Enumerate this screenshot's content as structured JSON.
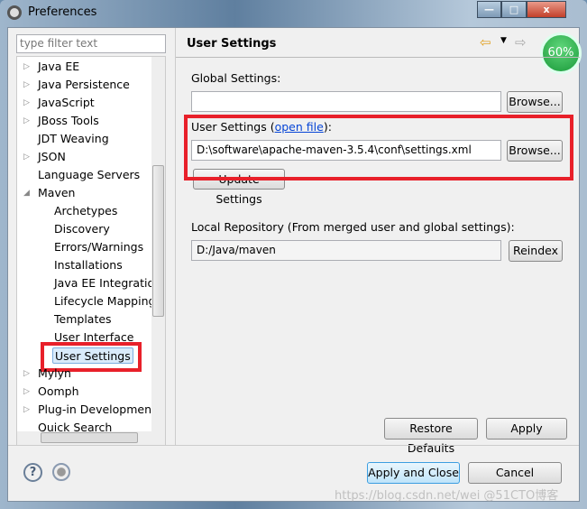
{
  "window": {
    "title": "Preferences",
    "minimize": "—",
    "maximize": "□",
    "close": "x"
  },
  "filter": {
    "placeholder": "type filter text"
  },
  "tree": [
    {
      "label": "Java EE",
      "level": 0,
      "expandable": true
    },
    {
      "label": "Java Persistence",
      "level": 0,
      "expandable": true
    },
    {
      "label": "JavaScript",
      "level": 0,
      "expandable": true
    },
    {
      "label": "JBoss Tools",
      "level": 0,
      "expandable": true
    },
    {
      "label": "JDT Weaving",
      "level": 0,
      "expandable": false
    },
    {
      "label": "JSON",
      "level": 0,
      "expandable": true
    },
    {
      "label": "Language Servers",
      "level": 0,
      "expandable": false
    },
    {
      "label": "Maven",
      "level": 0,
      "expandable": true,
      "expanded": true
    },
    {
      "label": "Archetypes",
      "level": 1
    },
    {
      "label": "Discovery",
      "level": 1
    },
    {
      "label": "Errors/Warnings",
      "level": 1
    },
    {
      "label": "Installations",
      "level": 1
    },
    {
      "label": "Java EE Integration",
      "level": 1
    },
    {
      "label": "Lifecycle Mappings",
      "level": 1
    },
    {
      "label": "Templates",
      "level": 1
    },
    {
      "label": "User Interface",
      "level": 1
    },
    {
      "label": "User Settings",
      "level": 1,
      "selected": true
    },
    {
      "label": "Mylyn",
      "level": 0,
      "expandable": true
    },
    {
      "label": "Oomph",
      "level": 0,
      "expandable": true
    },
    {
      "label": "Plug-in Development",
      "level": 0,
      "expandable": true
    },
    {
      "label": "Quick Search",
      "level": 0,
      "expandable": false
    }
  ],
  "page": {
    "title": "User Settings",
    "progress_badge": "60%",
    "global_label": "Global Settings:",
    "global_value": "",
    "browse": "Browse...",
    "user_label_prefix": "User Settings (",
    "open_file": "open file",
    "user_label_suffix": "):",
    "user_value": "D:\\software\\apache-maven-3.5.4\\conf\\settings.xml",
    "update_settings": "Update Settings",
    "local_repo_label": "Local Repository (From merged user and global settings):",
    "local_repo_value": "D:/Java/maven",
    "reindex": "Reindex",
    "restore_defaults": "Restore Defaults",
    "apply": "Apply"
  },
  "footer": {
    "apply_close": "Apply and Close",
    "cancel": "Cancel",
    "help_icon": "?",
    "watermark": "https://blog.csdn.net/wei @51CTO博客"
  }
}
